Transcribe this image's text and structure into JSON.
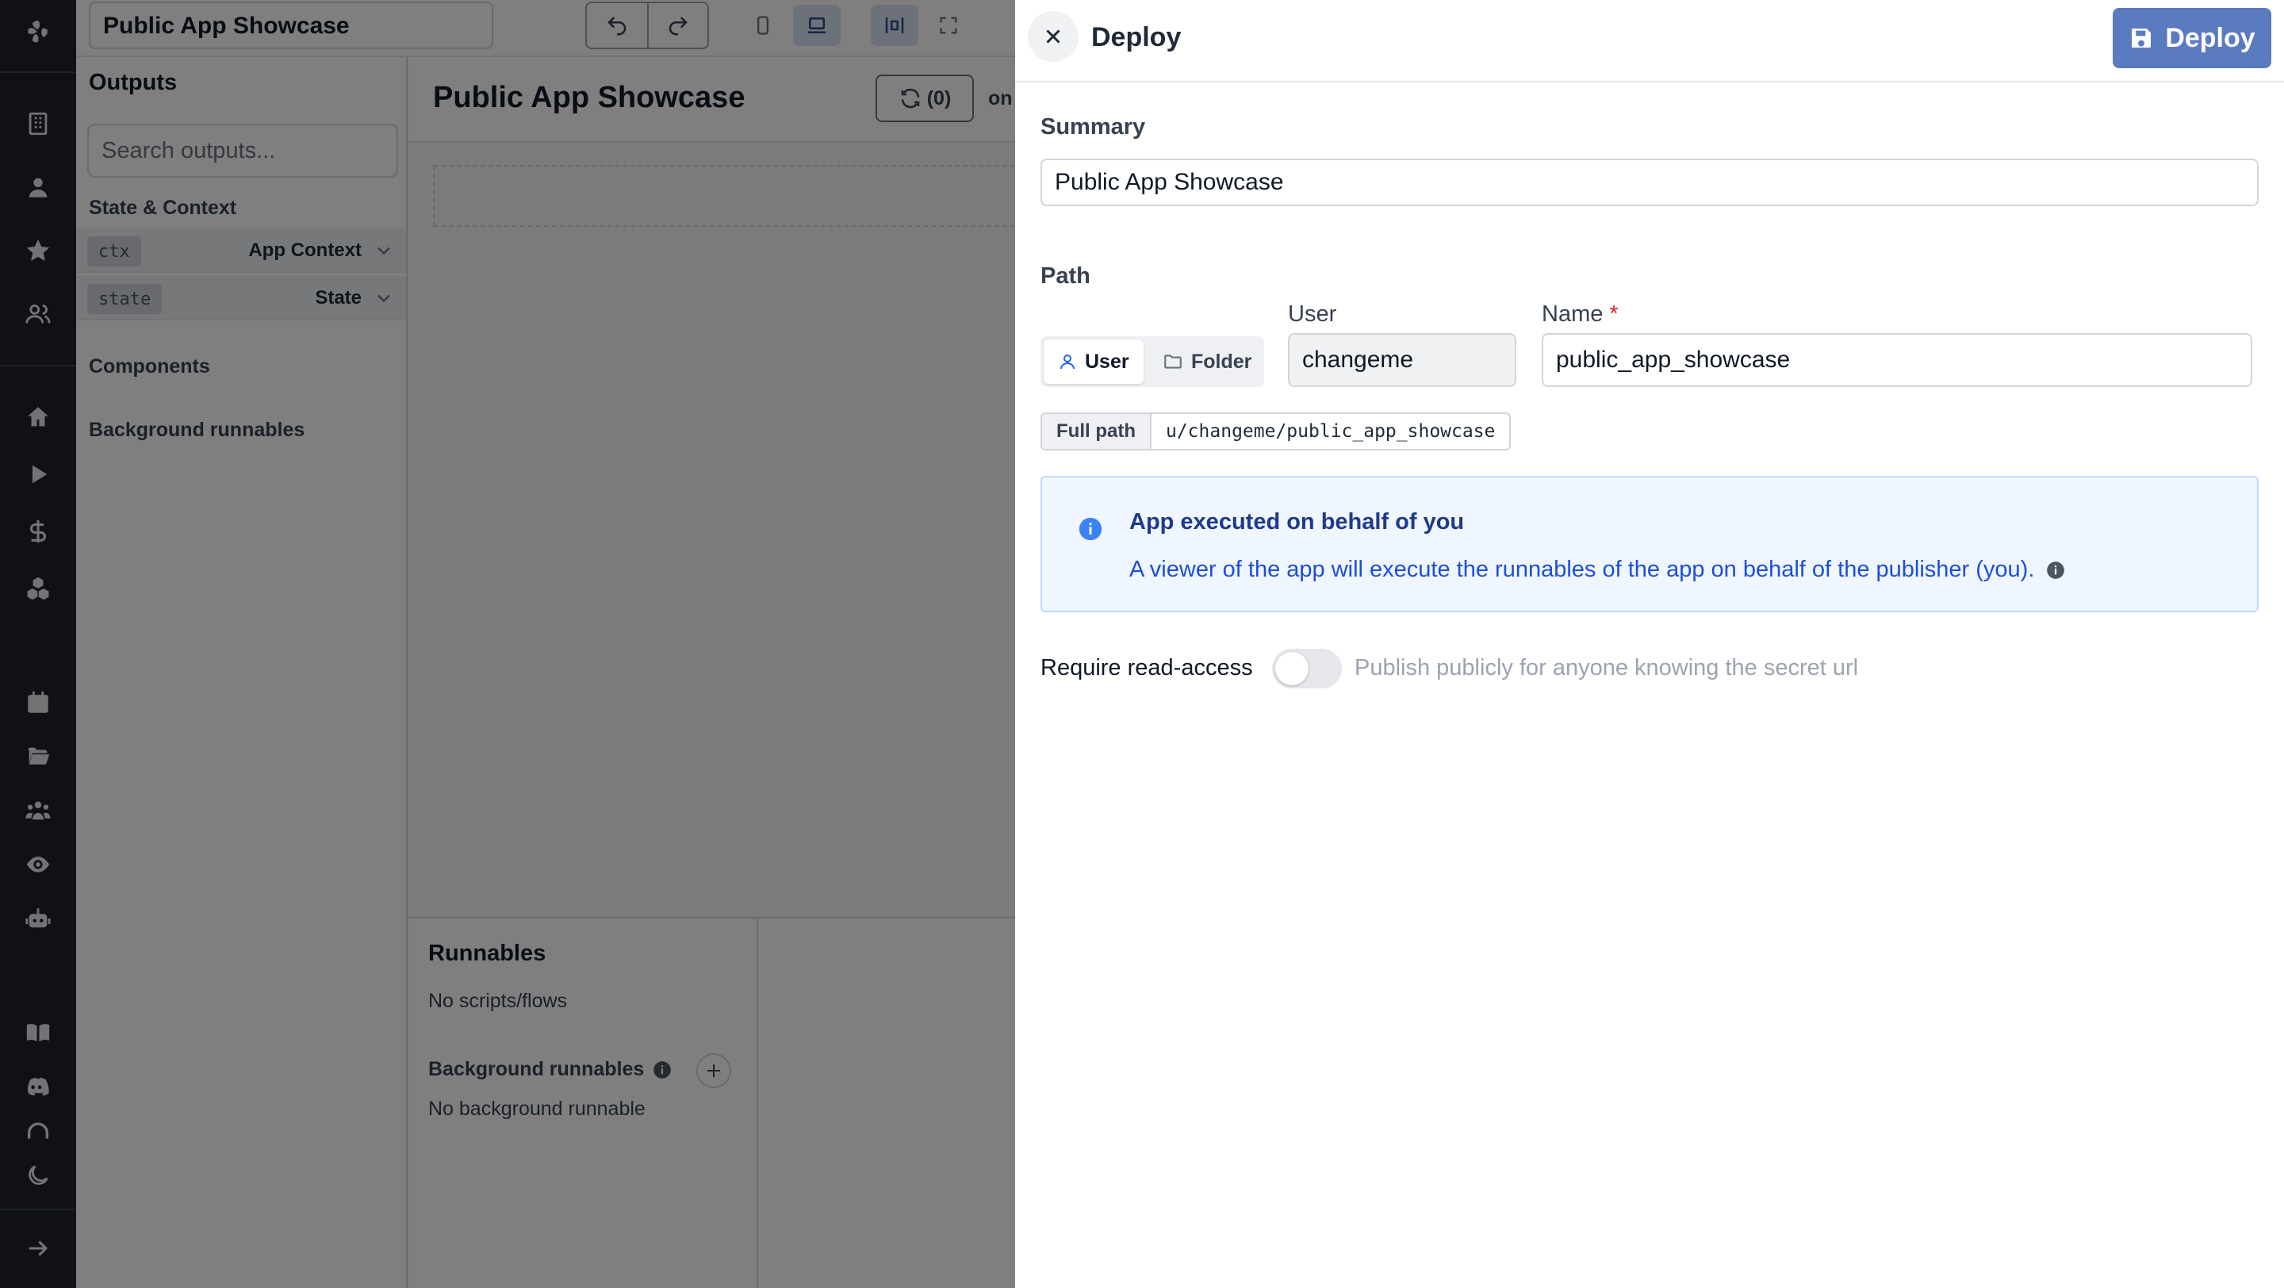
{
  "editor": {
    "app_title": "Public App Showcase",
    "outputs": {
      "heading": "Outputs",
      "search_placeholder": "Search outputs...",
      "state_context_label": "State & Context",
      "rows": [
        {
          "tag": "ctx",
          "label": "App Context"
        },
        {
          "tag": "state",
          "label": "State"
        }
      ],
      "components_label": "Components",
      "background_runnables_label": "Background runnables"
    },
    "canvas": {
      "title": "Public App Showcase",
      "refresh_count": "(0)",
      "on_text": "on"
    },
    "runnables": {
      "heading": "Runnables",
      "empty": "No scripts/flows",
      "background_heading": "Background runnables",
      "background_empty": "No background runnable"
    }
  },
  "drawer": {
    "title": "Deploy",
    "deploy_label": "Deploy",
    "summary": {
      "label": "Summary",
      "value": "Public App Showcase"
    },
    "path": {
      "label": "Path",
      "kind_options": [
        "User",
        "Folder"
      ],
      "selected_kind": "User",
      "user_label": "User",
      "user_value": "changeme",
      "name_label": "Name",
      "name_required": "*",
      "name_value": "public_app_showcase",
      "full_path_label": "Full path",
      "full_path_value": "u/changeme/public_app_showcase"
    },
    "info": {
      "title": "App executed on behalf of you",
      "body": "A viewer of the app will execute the runnables of the app on behalf of the publisher (you)."
    },
    "read_access": {
      "label": "Require read-access",
      "enabled": false,
      "help": "Publish publicly for anyone knowing the secret url"
    }
  },
  "colors": {
    "accent": "#5a7bbf",
    "rail": "#1e232e",
    "info_bg": "#eff6ff",
    "info_text": "#1d4ed8"
  },
  "icons": [
    "windmill-logo-icon",
    "building-icon",
    "user-icon",
    "star-icon",
    "users-icon",
    "home-icon",
    "play-icon",
    "dollar-icon",
    "boxes-icon",
    "calendar-icon",
    "folder-open-icon",
    "groups-icon",
    "eye-icon",
    "bot-icon",
    "book-icon",
    "discord-icon",
    "headphones-icon",
    "moon-icon",
    "arrow-right-icon"
  ]
}
